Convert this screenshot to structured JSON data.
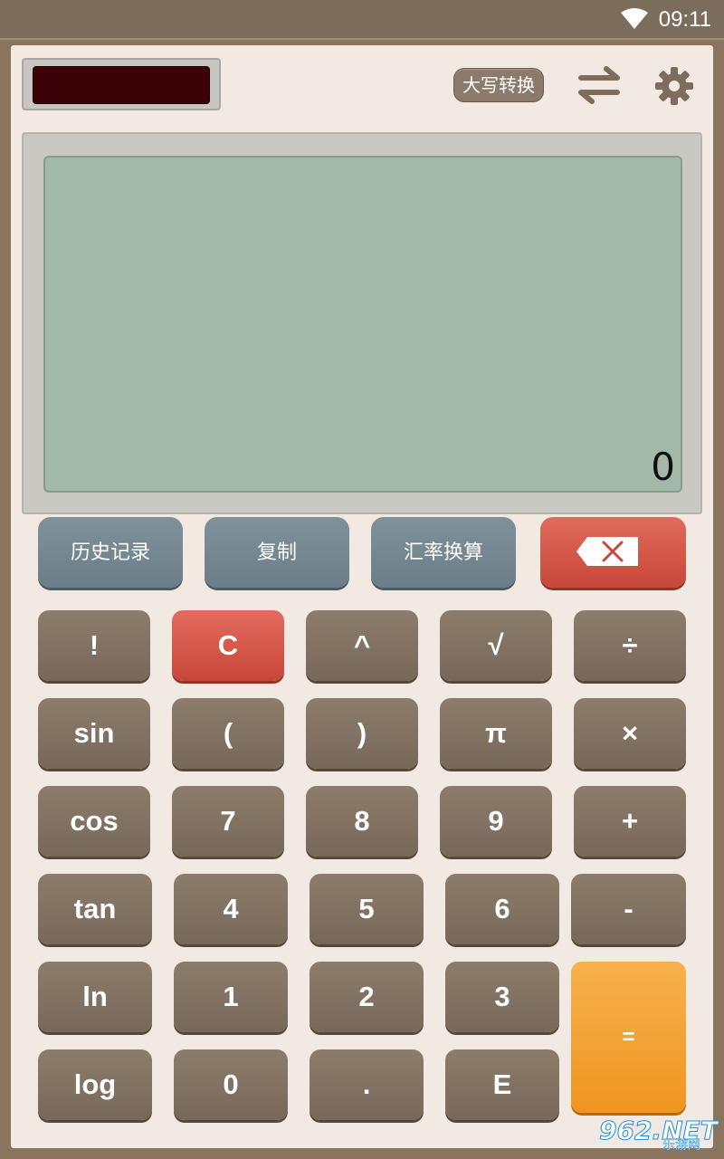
{
  "status_bar": {
    "time": "09:11"
  },
  "toolbar": {
    "caps_label": "大写转换"
  },
  "display": {
    "value": "0"
  },
  "function_row": [
    {
      "id": "history",
      "label": "历史记录"
    },
    {
      "id": "copy",
      "label": "复制"
    },
    {
      "id": "exchange",
      "label": "汇率换算"
    }
  ],
  "keys": {
    "fact": "!",
    "clear": "C",
    "pow": "^",
    "sqrt": "√",
    "div": "÷",
    "sin": "sin",
    "lparen": "(",
    "rparen": ")",
    "pi": "π",
    "mul": "×",
    "cos": "cos",
    "k7": "7",
    "k8": "8",
    "k9": "9",
    "plus": "+",
    "tan": "tan",
    "k4": "4",
    "k5": "5",
    "k6": "6",
    "minus": "-",
    "ln": "ln",
    "k1": "1",
    "k2": "2",
    "k3": "3",
    "equals": "=",
    "log": "log",
    "k0": "0",
    "dot": ".",
    "exp": "E"
  },
  "watermark": {
    "brand": "962.NET",
    "sub": "乐游网"
  },
  "colors": {
    "frame": "#8a745e",
    "panel": "#f3e9e3",
    "key": "#857565",
    "accent_red": "#d45a4c",
    "equals": "#f4a53a",
    "lcd": "#a2b8a9"
  }
}
